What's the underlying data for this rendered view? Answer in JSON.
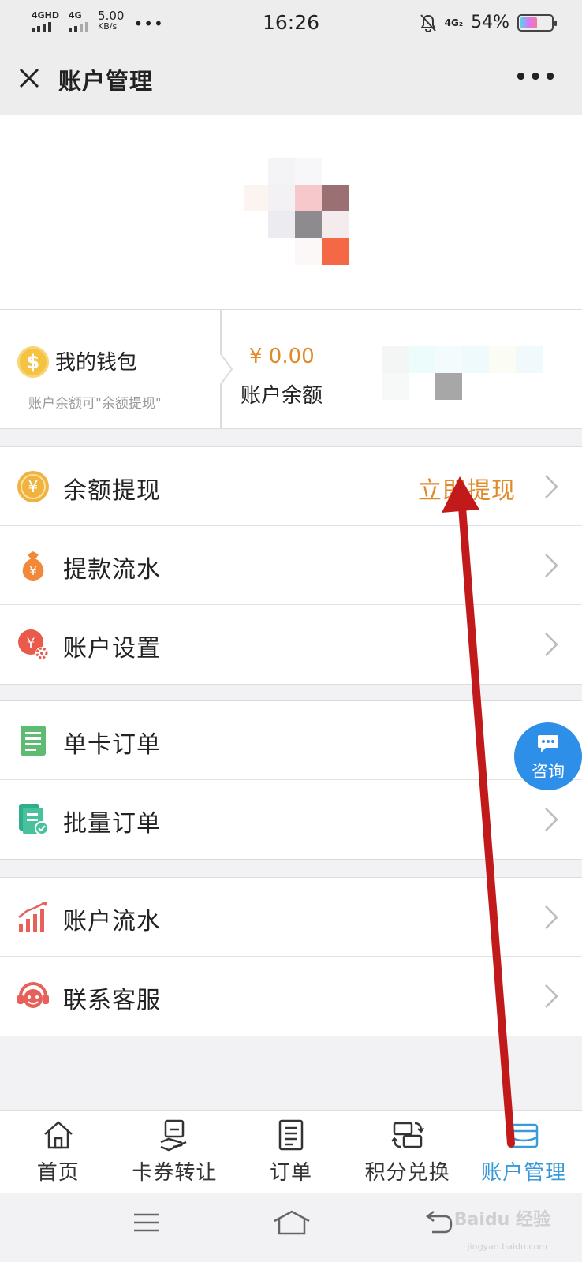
{
  "status_bar": {
    "signal1": "4GHD",
    "signal2": "4G",
    "speed_value": "5.00",
    "speed_unit": "KB/s",
    "time": "16:26",
    "network": "4G₂",
    "battery": "54%",
    "battery_level": 0.54
  },
  "header": {
    "title": "账户管理"
  },
  "wallet": {
    "title": "我的钱包",
    "subtitle": "账户余额可\"余额提现\"",
    "amount": "¥ 0.00",
    "amount_label": "账户余额"
  },
  "menu_groups": [
    {
      "items": [
        {
          "label": "余额提现",
          "value": "立即提现",
          "icon": "yuan-coin-icon"
        },
        {
          "label": "提款流水",
          "value": "",
          "icon": "money-bag-icon"
        },
        {
          "label": "账户设置",
          "value": "",
          "icon": "yuan-gear-icon"
        }
      ]
    },
    {
      "items": [
        {
          "label": "单卡订单",
          "value": "",
          "icon": "document-icon"
        },
        {
          "label": "批量订单",
          "value": "",
          "icon": "document-check-icon"
        }
      ]
    },
    {
      "items": [
        {
          "label": "账户流水",
          "value": "",
          "icon": "bar-chart-icon"
        },
        {
          "label": "联系客服",
          "value": "",
          "icon": "customer-service-icon"
        }
      ]
    }
  ],
  "consult": {
    "label": "咨询",
    "icon": "chat-bubble-icon"
  },
  "tabs": [
    {
      "label": "首页",
      "icon": "home-icon",
      "active": false
    },
    {
      "label": "卡券转让",
      "icon": "card-transfer-icon",
      "active": false
    },
    {
      "label": "订单",
      "icon": "list-document-icon",
      "active": false
    },
    {
      "label": "积分兑换",
      "icon": "exchange-icon",
      "active": false
    },
    {
      "label": "账户管理",
      "icon": "wallet-icon",
      "active": true
    }
  ],
  "watermark": {
    "text": "Baidu 经验",
    "sub": "jingyan.baidu.com"
  },
  "colors": {
    "accent_orange": "#e08a2a",
    "tab_active": "#3a9ad9",
    "consult_blue": "#2d8fe8",
    "annotation_arrow": "#c21a1a"
  }
}
